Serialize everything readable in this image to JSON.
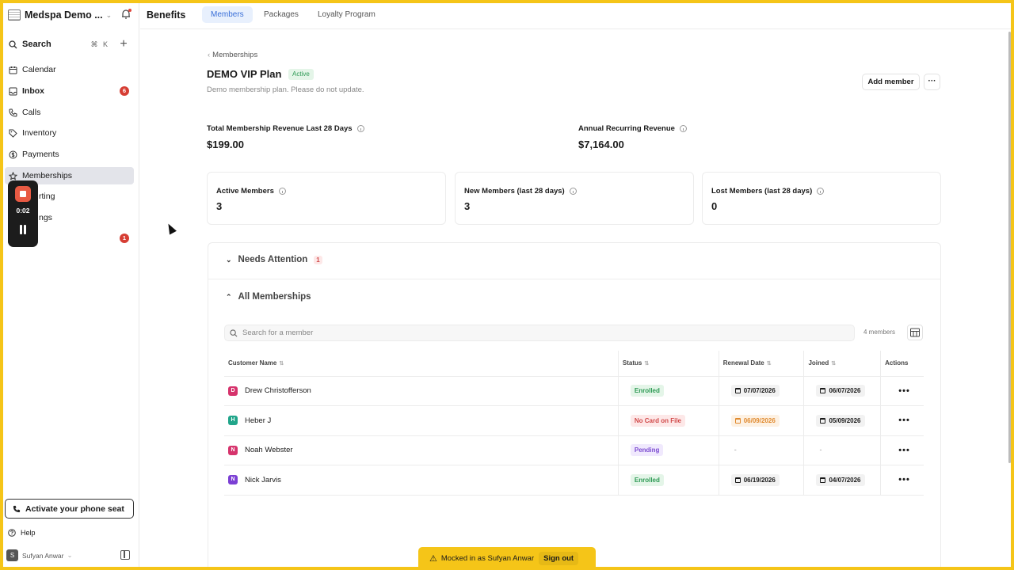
{
  "sidebar": {
    "workspace": "Medspa Demo ...",
    "search_label": "Search",
    "search_shortcut": "⌘ K",
    "nav": [
      {
        "label": "Calendar"
      },
      {
        "label": "Inbox",
        "badge": "6"
      },
      {
        "label": "Calls"
      },
      {
        "label": "Inventory"
      },
      {
        "label": "Payments"
      },
      {
        "label": "Memberships"
      },
      {
        "label": "rting"
      },
      {
        "label": "ngs"
      },
      {
        "label": "",
        "badge": "1"
      }
    ],
    "phone_seat": "Activate your phone seat",
    "help": "Help",
    "user": "Sufyan Anwar",
    "user_initial": "S"
  },
  "recorder": {
    "time": "0:02"
  },
  "topbar": {
    "title": "Benefits",
    "tabs": [
      "Members",
      "Packages",
      "Loyalty Program"
    ]
  },
  "plan": {
    "breadcrumb": "Memberships",
    "title": "DEMO VIP Plan",
    "status": "Active",
    "description": "Demo membership plan. Please do not update.",
    "add_member": "Add member",
    "more": "···"
  },
  "stats": {
    "revenue_label": "Total Membership Revenue Last 28 Days",
    "revenue_value": "$199.00",
    "arr_label": "Annual Recurring Revenue",
    "arr_value": "$7,164.00",
    "cards": [
      {
        "label": "Active Members",
        "value": "3"
      },
      {
        "label": "New Members (last 28 days)",
        "value": "3"
      },
      {
        "label": "Lost Members (last 28 days)",
        "value": "0"
      }
    ]
  },
  "sections": {
    "needs_attention": "Needs Attention",
    "needs_attention_count": "1",
    "all_memberships": "All Memberships"
  },
  "table": {
    "search_placeholder": "Search for a member",
    "members_count": "4 members",
    "headers": [
      "Customer Name",
      "Status",
      "Renewal Date",
      "Joined",
      "Actions"
    ],
    "rows": [
      {
        "initial": "D",
        "color": "#d6336c",
        "name": "Drew Christofferson",
        "status": "Enrolled",
        "renewal": "07/07/2026",
        "joined": "06/07/2026"
      },
      {
        "initial": "H",
        "color": "#20a58a",
        "name": "Heber J",
        "status": "No Card on File",
        "renewal": "06/09/2026",
        "joined": "05/09/2026"
      },
      {
        "initial": "N",
        "color": "#d6336c",
        "name": "Noah Webster",
        "status": "Pending",
        "renewal": "-",
        "joined": "-"
      },
      {
        "initial": "N",
        "color": "#7b3fd4",
        "name": "Nick Jarvis",
        "status": "Enrolled",
        "renewal": "06/19/2026",
        "joined": "04/07/2026"
      }
    ]
  },
  "banner": {
    "text": "Mocked in as Sufyan Anwar",
    "signout": "Sign out"
  },
  "colors": {
    "frame": "#f5c518",
    "tab_active": "#3a6fd8",
    "badge": "#d63e34",
    "enrolled": "#2e9a55",
    "no_card": "#d14b4b",
    "pending": "#7a4ad0",
    "warn_date": "#e08a2f"
  }
}
